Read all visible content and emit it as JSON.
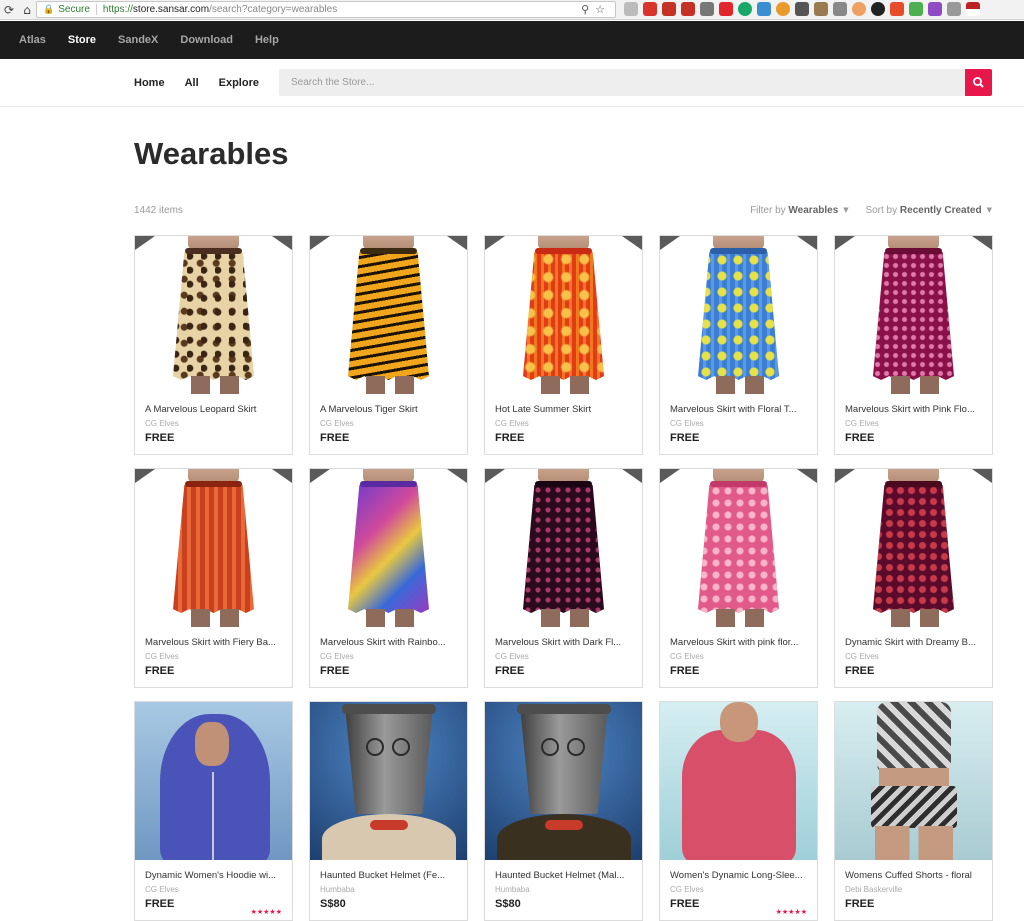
{
  "browser": {
    "secure_label": "Secure",
    "url_scheme": "https://",
    "url_host": "store.sansar.com",
    "url_path": "/search?category=wearables"
  },
  "topnav": {
    "items": [
      {
        "label": "Atlas",
        "active": false
      },
      {
        "label": "Store",
        "active": true
      },
      {
        "label": "SandeX",
        "active": false
      },
      {
        "label": "Download",
        "active": false
      },
      {
        "label": "Help",
        "active": false
      }
    ]
  },
  "subnav": {
    "home": "Home",
    "all": "All",
    "explore": "Explore",
    "search_placeholder": "Search the Store..."
  },
  "page": {
    "title": "Wearables",
    "count": "1442 items",
    "filter_label": "Filter by",
    "filter_value": "Wearables",
    "sort_label": "Sort by",
    "sort_value": "Recently Created"
  },
  "colors": {
    "accent": "#e8174b",
    "topnav_bg": "#1c1c1c"
  },
  "products": [
    {
      "name": "A Marvelous Leopard Skirt",
      "creator": "CG Elves",
      "price": "FREE",
      "stars": 0
    },
    {
      "name": "A Marvelous Tiger Skirt",
      "creator": "CG Elves",
      "price": "FREE",
      "stars": 0
    },
    {
      "name": "Hot Late Summer Skirt",
      "creator": "CG Elves",
      "price": "FREE",
      "stars": 0
    },
    {
      "name": "Marvelous Skirt with Floral T...",
      "creator": "CG Elves",
      "price": "FREE",
      "stars": 0
    },
    {
      "name": "Marvelous Skirt with Pink Flo...",
      "creator": "CG Elves",
      "price": "FREE",
      "stars": 0
    },
    {
      "name": "Marvelous Skirt with Fiery Ba...",
      "creator": "CG Elves",
      "price": "FREE",
      "stars": 0
    },
    {
      "name": "Marvelous Skirt with Rainbo...",
      "creator": "CG Elves",
      "price": "FREE",
      "stars": 0
    },
    {
      "name": "Marvelous Skirt with Dark Fl...",
      "creator": "CG Elves",
      "price": "FREE",
      "stars": 0
    },
    {
      "name": "Marvelous Skirt with pink flor...",
      "creator": "CG Elves",
      "price": "FREE",
      "stars": 0
    },
    {
      "name": "Dynamic Skirt with Dreamy B...",
      "creator": "CG Elves",
      "price": "FREE",
      "stars": 0
    },
    {
      "name": "Dynamic Women's Hoodie wi...",
      "creator": "CG Elves",
      "price": "FREE",
      "stars": 5
    },
    {
      "name": "Haunted Bucket Helmet (Fe...",
      "creator": "Humbaba",
      "price": "S$80",
      "stars": 0
    },
    {
      "name": "Haunted Bucket Helmet (Mal...",
      "creator": "Humbaba",
      "price": "S$80",
      "stars": 0
    },
    {
      "name": "Women's Dynamic Long-Slee...",
      "creator": "CG Elves",
      "price": "FREE",
      "stars": 5
    },
    {
      "name": "Womens Cuffed Shorts - floral",
      "creator": "Debi Baskerville",
      "price": "FREE",
      "stars": 0
    }
  ]
}
